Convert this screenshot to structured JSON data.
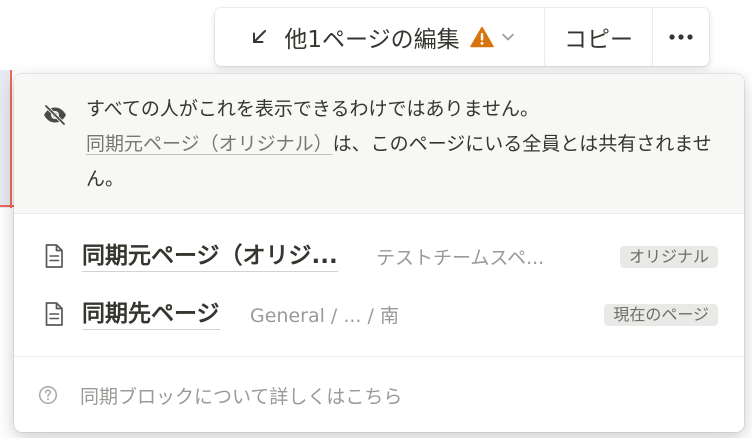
{
  "toolbar": {
    "edit_label": "他1ページの編集",
    "copy_label": "コピー",
    "warning_color": "#d9730d",
    "icons": {
      "edit_arrow": "arrow-down-left-icon",
      "warning": "warning-triangle-icon",
      "dropdown": "chevron-down-icon",
      "more": "ellipsis-icon"
    }
  },
  "popover": {
    "notice": {
      "icon": "eye-slash-icon",
      "line1": "すべての人がこれを表示できるわけではありません。",
      "link": "同期元ページ（オリジナル）",
      "line2_rest": "は、このページにいる全員とは共有されません。"
    },
    "pages": [
      {
        "icon": "page-icon",
        "title": "同期元ページ（オリジ...",
        "path": "テストチームスペ...",
        "badge": "オリジナル"
      },
      {
        "icon": "page-icon",
        "title": "同期先ページ",
        "path": "General / ... / 南",
        "badge": "現在のページ"
      }
    ],
    "help": {
      "icon": "help-circle-icon",
      "text": "同期ブロックについて詳しくはこちら"
    }
  }
}
